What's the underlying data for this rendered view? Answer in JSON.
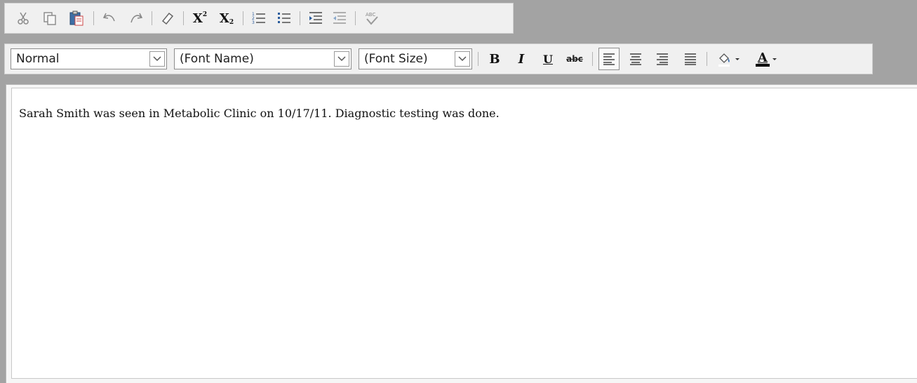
{
  "toolbar_top": {
    "icons": [
      "cut-icon",
      "copy-icon",
      "paste-icon",
      "undo-icon",
      "redo-icon",
      "eraser-icon",
      "superscript-icon",
      "subscript-icon",
      "ordered-list-icon",
      "unordered-list-icon",
      "indent-icon",
      "outdent-icon",
      "spellcheck-icon"
    ],
    "superscript_label": "X",
    "subscript_label": "X",
    "spellcheck_label": "ABC"
  },
  "toolbar_format": {
    "paragraph_style": "Normal",
    "font_name": "(Font Name)",
    "font_size": "(Font Size)",
    "bold_label": "B",
    "italic_label": "I",
    "underline_label": "U",
    "strike_label": "abc",
    "font_color_label": "A",
    "active_alignment": "left"
  },
  "document": {
    "text": "Sarah Smith was seen in Metabolic Clinic on 10/17/11. Diagnostic testing was done."
  }
}
